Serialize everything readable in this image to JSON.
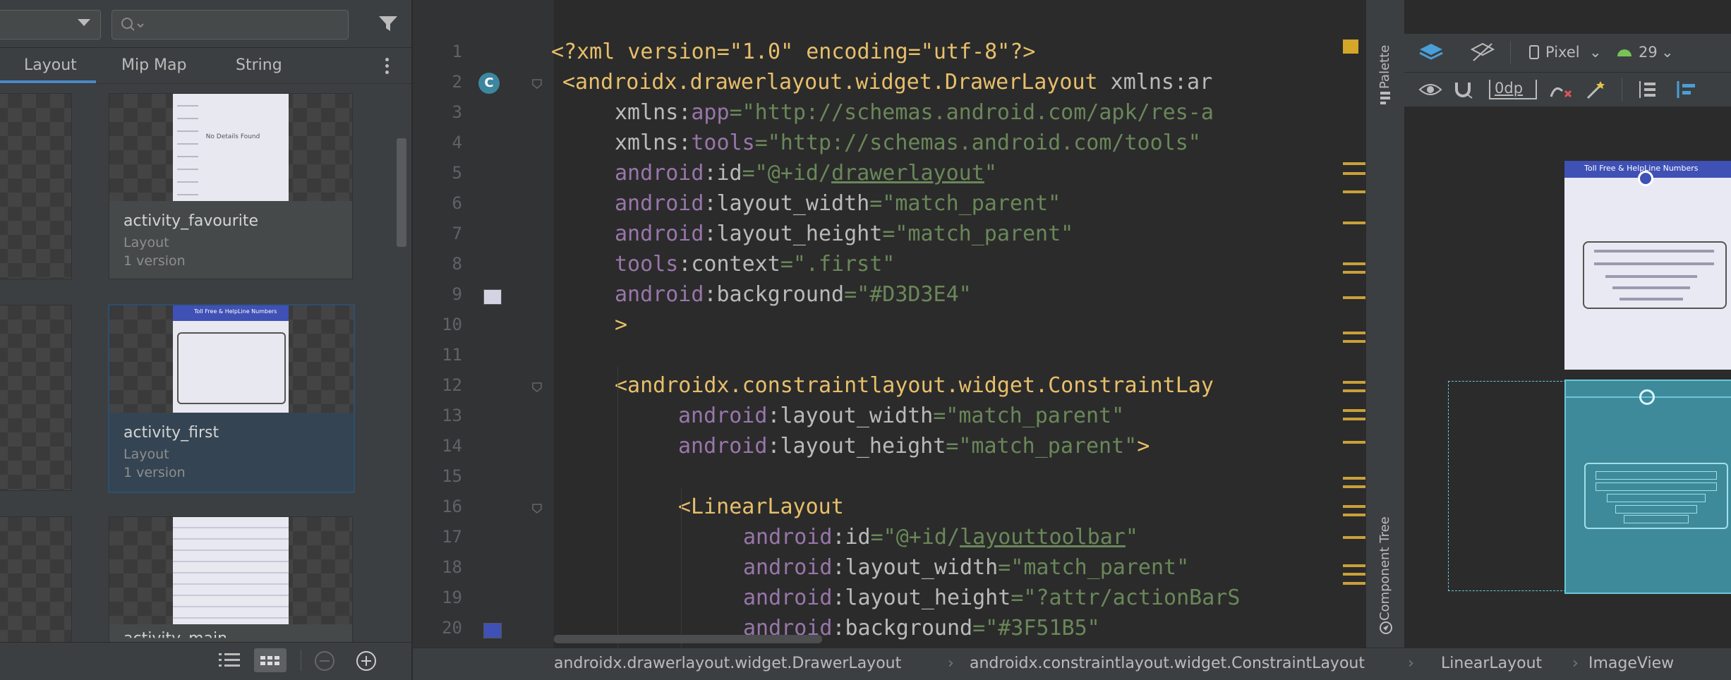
{
  "resource_manager": {
    "tabs": [
      {
        "label": "Layout"
      },
      {
        "label": "Mip Map"
      },
      {
        "label": "String"
      }
    ],
    "cards": [
      {
        "name": "activity_favourite",
        "type": "Layout",
        "version": "1 version",
        "preview_text": "No Details Found"
      },
      {
        "name": "activity_first",
        "type": "Layout",
        "version": "1 version",
        "preview_title": "Toll Free & HelpLine Numbers"
      },
      {
        "name": "activity_main",
        "type": "Layout",
        "version": "1 version"
      }
    ]
  },
  "editor": {
    "lines": [
      {
        "n": "1"
      },
      {
        "n": "2"
      },
      {
        "n": "3"
      },
      {
        "n": "4"
      },
      {
        "n": "5"
      },
      {
        "n": "6"
      },
      {
        "n": "7"
      },
      {
        "n": "8"
      },
      {
        "n": "9"
      },
      {
        "n": "10"
      },
      {
        "n": "11"
      },
      {
        "n": "12"
      },
      {
        "n": "13"
      },
      {
        "n": "14"
      },
      {
        "n": "15"
      },
      {
        "n": "16"
      },
      {
        "n": "17"
      },
      {
        "n": "18"
      },
      {
        "n": "19"
      },
      {
        "n": "20"
      }
    ],
    "code": {
      "l1": "<?xml version=\"1.0\" encoding=\"utf-8\"?>",
      "l2_tag": "<androidx.drawerlayout.widget.DrawerLayout",
      "l2_attr": " xmlns:ar",
      "l3_ns": "xmlns:",
      "l3_attr": "app",
      "l3_val": "=\"http://schemas.android.com/apk/res-a",
      "l4_ns": "xmlns:",
      "l4_attr": "tools",
      "l4_val": "=\"http://schemas.android.com/tools\"",
      "l5_ns": "android",
      "l5_attr": ":id",
      "l5_val1": "=\"@+id/",
      "l5_val2": "drawerlayout",
      "l5_val3": "\"",
      "l6_ns": "android",
      "l6_attr": ":layout_width",
      "l6_val": "=\"match_parent\"",
      "l7_ns": "android",
      "l7_attr": ":layout_height",
      "l7_val": "=\"match_parent\"",
      "l8_ns": "tools",
      "l8_attr": ":context",
      "l8_val": "=\".first\"",
      "l9_ns": "android",
      "l9_attr": ":background",
      "l9_val": "=\"#D3D3E4\"",
      "l10": ">",
      "l12": "<androidx.constraintlayout.widget.ConstraintLay",
      "l13_ns": "android",
      "l13_attr": ":layout_width",
      "l13_val": "=\"match_parent\"",
      "l14_ns": "android",
      "l14_attr": ":layout_height",
      "l14_val": "=\"match_parent\"",
      "l14_end": ">",
      "l16": "<LinearLayout",
      "l17_ns": "android",
      "l17_attr": ":id",
      "l17_val1": "=\"@+id/",
      "l17_val2": "layouttoolbar",
      "l17_val3": "\"",
      "l18_ns": "android",
      "l18_attr": ":layout_width",
      "l18_val": "=\"match_parent\"",
      "l19_ns": "android",
      "l19_attr": ":layout_height",
      "l19_val": "=\"?attr/actionBarS",
      "l20_ns": "android",
      "l20_attr": ":background",
      "l20_val": "=\"#3F51B5\""
    },
    "swatch_colors": {
      "line9": "#D3D3E4",
      "line20": "#3F51B5"
    },
    "badge": "C"
  },
  "side_strip": {
    "palette": "Palette",
    "component_tree": "Component Tree"
  },
  "designer": {
    "device": "Pixel",
    "api": "29",
    "margin": "0dp",
    "screen_title": "Toll Free & HelpLine Numbers"
  },
  "breadcrumbs": [
    "androidx.drawerlayout.widget.DrawerLayout",
    "androidx.constraintlayout.widget.ConstraintLayout",
    "LinearLayout",
    "ImageView"
  ],
  "colors": {
    "accent": "#4a88c7",
    "background": "#2b2b2b",
    "panel": "#3c3f41",
    "tag": "#e8bf6a",
    "namespace": "#9876aa",
    "value": "#6a8759"
  }
}
